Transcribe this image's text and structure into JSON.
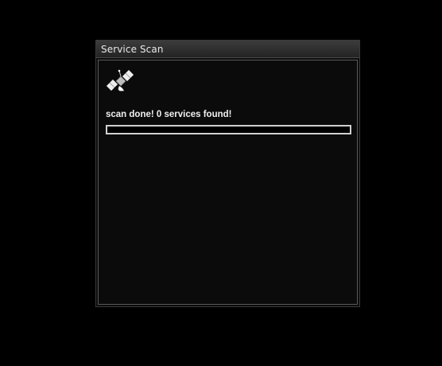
{
  "dialog": {
    "title": "Service Scan",
    "icon": "satellite-icon",
    "status": "scan done! 0 services found!",
    "progress": 0
  },
  "colors": {
    "background": "#000000",
    "panel": "#0b0b0b",
    "text": "#f0f0f0",
    "progress_border": "#d0d0d0"
  }
}
